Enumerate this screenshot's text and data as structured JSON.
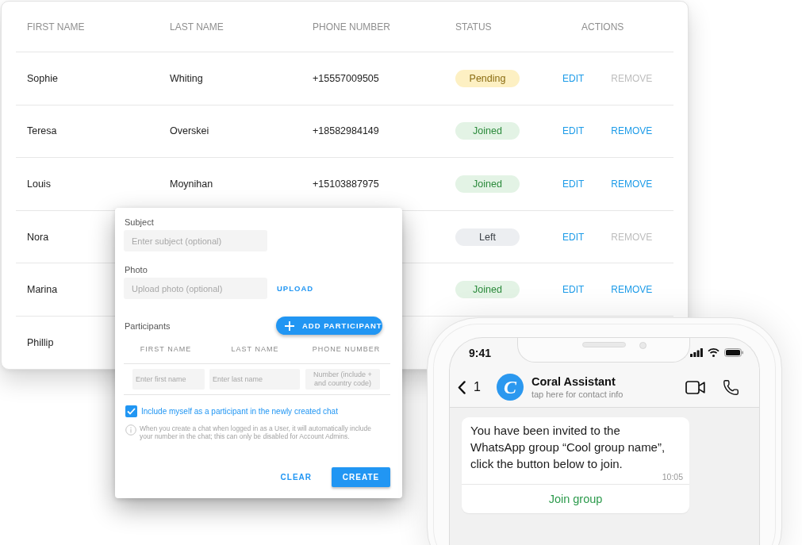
{
  "contacts_table": {
    "columns": [
      "FIRST NAME",
      "LAST NAME",
      "PHONE NUMBER",
      "STATUS",
      "ACTIONS"
    ],
    "rows": [
      {
        "first_name": "Sophie",
        "last_name": "Whiting",
        "phone_number": "+15557009505",
        "status": {
          "label": "Pending",
          "kind": "pending"
        },
        "actions": [
          {
            "label": "EDIT",
            "disabled": false
          },
          {
            "label": "REMOVE",
            "disabled": true
          }
        ]
      },
      {
        "first_name": "Teresa",
        "last_name": "Overskei",
        "phone_number": "+18582984149",
        "status": {
          "label": "Joined",
          "kind": "joined"
        },
        "actions": [
          {
            "label": "EDIT",
            "disabled": false
          },
          {
            "label": "REMOVE",
            "disabled": false
          }
        ]
      },
      {
        "first_name": "Louis",
        "last_name": "Moynihan",
        "phone_number": "+15103887975",
        "status": {
          "label": "Joined",
          "kind": "joined"
        },
        "actions": [
          {
            "label": "EDIT",
            "disabled": false
          },
          {
            "label": "REMOVE",
            "disabled": false
          }
        ]
      },
      {
        "first_name": "Nora",
        "status": {
          "label": "Left",
          "kind": "left"
        },
        "actions": [
          {
            "label": "EDIT",
            "disabled": false
          },
          {
            "label": "REMOVE",
            "disabled": true
          }
        ]
      },
      {
        "first_name": "Marina",
        "status": {
          "label": "Joined",
          "kind": "joined"
        },
        "actions": [
          {
            "label": "EDIT",
            "disabled": false
          },
          {
            "label": "REMOVE",
            "disabled": false
          }
        ]
      },
      {
        "first_name": "Phillip"
      }
    ]
  },
  "create_chat_dialog": {
    "subject": {
      "label": "Subject",
      "placeholder": "Enter subject (optional)"
    },
    "photo": {
      "label": "Photo",
      "placeholder": "Upload photo (optional)",
      "upload_button": "UPLOAD"
    },
    "participants": {
      "label": "Participants",
      "add_button": "ADD PARTICIPANT",
      "columns": [
        "FIRST NAME",
        "LAST NAME",
        "PHONE NUMBER"
      ],
      "new_row": [
        {
          "placeholder": "Enter first name"
        },
        {
          "placeholder": "Enter last name"
        },
        {
          "placeholder": "Number (include + and country code)"
        }
      ]
    },
    "include_self": {
      "label": "Include myself as a participant in the newly created chat",
      "checked": true
    },
    "note": "When you create a chat when logged in as a User, it will automatically include your number in the chat; this can only be disabled for Account Admins.",
    "buttons": [
      {
        "label": "CLEAR",
        "kind": "text"
      },
      {
        "label": "CREATE",
        "kind": "contained"
      }
    ]
  },
  "phone": {
    "status_bar": {
      "time": "9:41"
    },
    "chat_header": {
      "back_count": "1",
      "avatar_letter": "C",
      "name": "Coral Assistant",
      "subtitle": "tap here for contact info"
    },
    "message": {
      "text": "You have been invited to the WhatsApp group “Cool group name”, click the button below to join.",
      "time": "10:05",
      "button": "Join group"
    }
  }
}
